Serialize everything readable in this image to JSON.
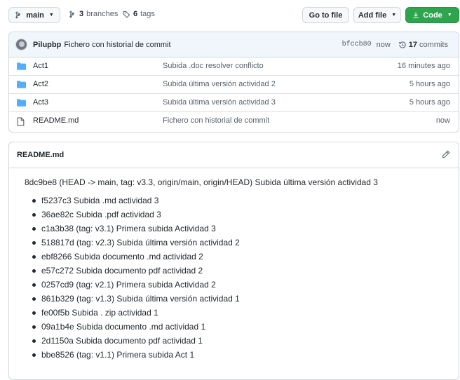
{
  "toolbar": {
    "branch": "main",
    "branches_count": "3",
    "branches_label": "branches",
    "tags_count": "6",
    "tags_label": "tags",
    "goto_file": "Go to file",
    "add_file": "Add file",
    "code": "Code"
  },
  "latest_commit": {
    "author": "Pilupbp",
    "message": "Fichero con historial de commit",
    "sha": "bfccb80",
    "time": "now",
    "commits_count": "17",
    "commits_label": "commits"
  },
  "files": [
    {
      "name": "Act1",
      "type": "folder",
      "message": "Subida .doc resolver conflicto",
      "age": "16 minutes ago"
    },
    {
      "name": "Act2",
      "type": "folder",
      "message": "Subida última versión actividad 2",
      "age": "5 hours ago"
    },
    {
      "name": "Act3",
      "type": "folder",
      "message": "Subida última versión actividad 3",
      "age": "5 hours ago"
    },
    {
      "name": "README.md",
      "type": "file",
      "message": "Fichero con historial de commit",
      "age": "now"
    }
  ],
  "readme": {
    "title": "README.md",
    "lead": "8dc9be8 (HEAD -> main, tag: v3.3, origin/main, origin/HEAD) Subida última versión actividad 3",
    "items": [
      "f5237c3 Subida .md actividad 3",
      "36ae82c Subida .pdf actividad 3",
      "c1a3b38 (tag: v3.1) Primera subida Actividad 3",
      "518817d (tag: v2.3) Subida última versión actividad 2",
      "ebf8266 Subida documento .md actividad 2",
      "e57c272 Subida documento pdf actividad 2",
      "0257cd9 (tag: v2.1) Primera subida Actividad 2",
      "861b329 (tag: v1.3) Subida última versión actividad 1",
      "fe00f5b Subida . zip actividad 1",
      "09a1b4e Subida documento .md actividad 1",
      "2d1150a Subida documento pdf actividad 1",
      "bbe8526 (tag: v1.1) Primera subida Act 1"
    ]
  },
  "colors": {
    "accent_green": "#2da44e",
    "folder_blue": "#54aeff",
    "commit_bar_bg": "#f1f6fd"
  },
  "icons": [
    "git-branch-icon",
    "tag-icon",
    "history-icon",
    "folder-icon",
    "file-icon",
    "pencil-icon",
    "download-icon"
  ]
}
